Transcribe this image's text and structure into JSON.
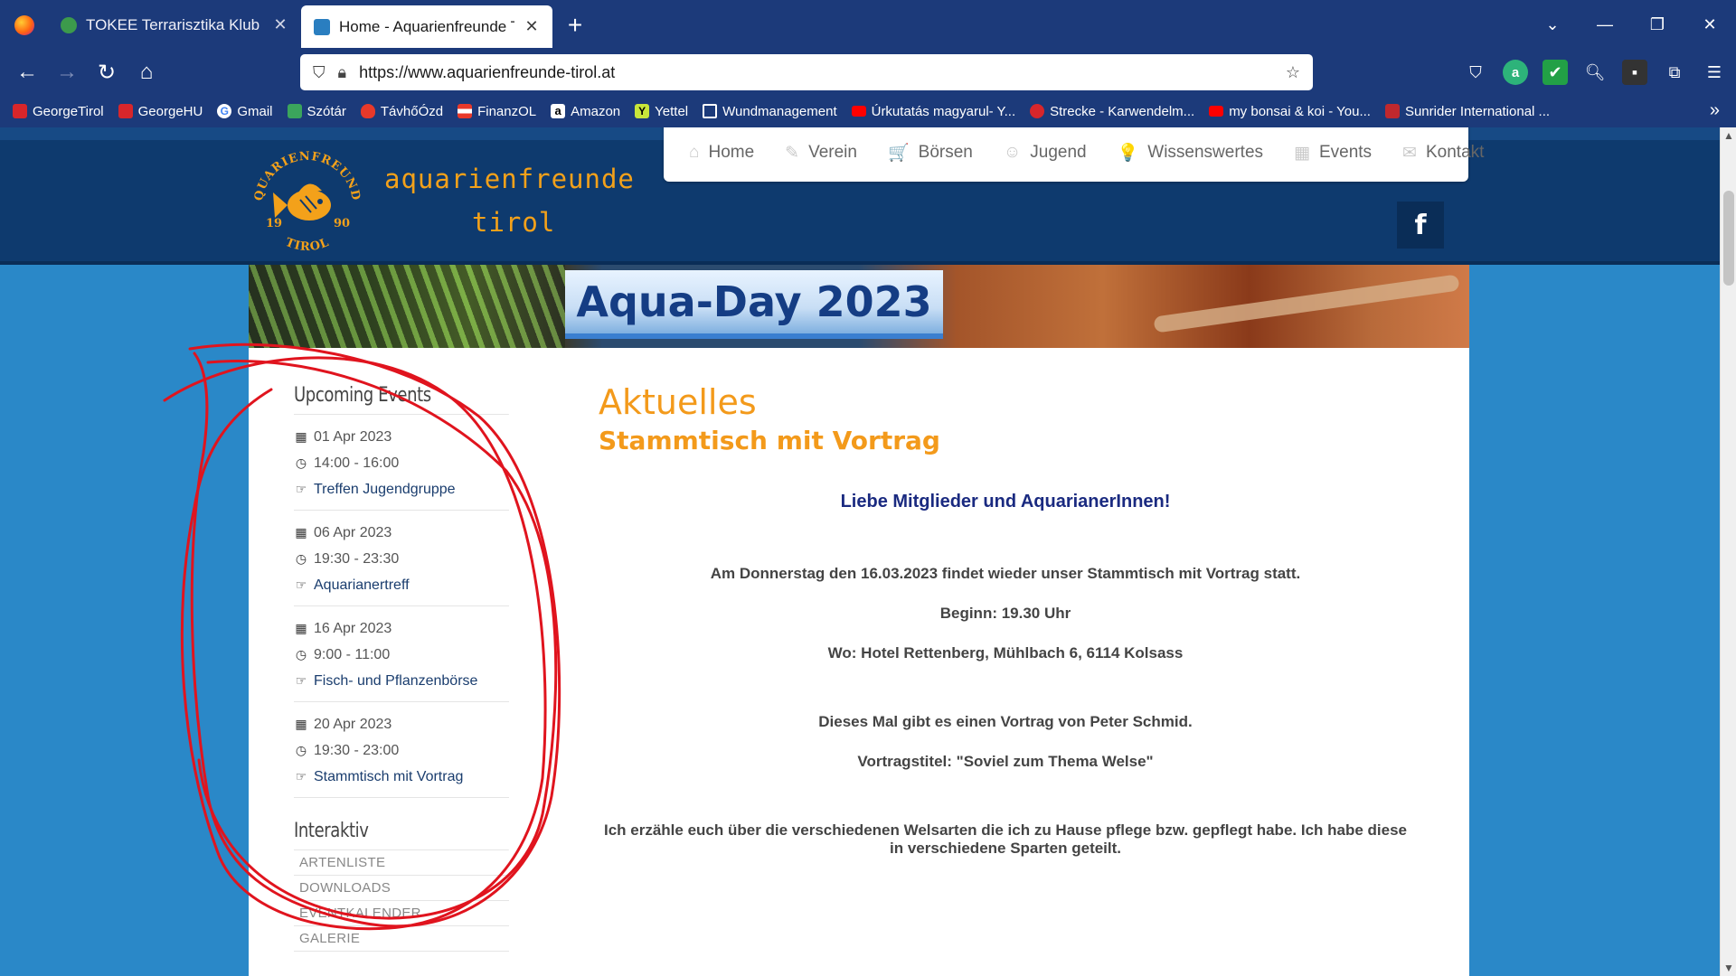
{
  "browser": {
    "tabs": [
      {
        "title": "TOKEE Terrarisztika Klub NET - (",
        "favicon_color": "#3c9a4c",
        "active": false
      },
      {
        "title": "Home - Aquarienfreunde Tirol",
        "favicon_color": "#2a7ec0",
        "active": true
      }
    ],
    "new_tab": "+",
    "url": "https://www.aquarienfreunde-tirol.at",
    "bookmarks": [
      {
        "label": "GeorgeTirol",
        "color": "#d8262b"
      },
      {
        "label": "GeorgeHU",
        "color": "#d8262b"
      },
      {
        "label": "Gmail",
        "color": "#ffffff"
      },
      {
        "label": "Szótár",
        "color": "#3ba55c"
      },
      {
        "label": "TávhőÓzd",
        "color": "#e8392a"
      },
      {
        "label": "FinanzOL",
        "color": "#e8392a"
      },
      {
        "label": "Amazon",
        "color": "#ffffff"
      },
      {
        "label": "Yettel",
        "color": "#c8e63a"
      },
      {
        "label": "Wundmanagement",
        "color": "#1c3a7a"
      },
      {
        "label": "Úrkutatás magyarul- Y...",
        "color": "#ff0000"
      },
      {
        "label": "Strecke - Karwendelm...",
        "color": "#d8262b"
      },
      {
        "label": "my bonsai & koi - You...",
        "color": "#ff0000"
      },
      {
        "label": "Sunrider International ...",
        "color": "#c0282d"
      }
    ]
  },
  "site": {
    "brand_line1": "aquarienfreunde",
    "brand_line2": "tirol",
    "logo_text_top": "AQUARIENFREUNDE",
    "logo_text_bottom": "TIROL",
    "logo_year_left": "19",
    "logo_year_right": "90",
    "menu": [
      {
        "label": "Home",
        "icon": "home-icon",
        "glyph": "⌂"
      },
      {
        "label": "Verein",
        "icon": "pin-icon",
        "glyph": "✎"
      },
      {
        "label": "Börsen",
        "icon": "cart-icon",
        "glyph": "🛒"
      },
      {
        "label": "Jugend",
        "icon": "smiley-icon",
        "glyph": "☺"
      },
      {
        "label": "Wissenswertes",
        "icon": "lightbulb-icon",
        "glyph": "💡"
      },
      {
        "label": "Events",
        "icon": "calendar-icon",
        "glyph": "▦"
      },
      {
        "label": "Kontakt",
        "icon": "envelope-icon",
        "glyph": "✉"
      }
    ],
    "facebook": "f",
    "banner_title": "Aqua-Day 2023"
  },
  "sidebar": {
    "upcoming_title": "Upcoming Events",
    "events": [
      {
        "date": "01 Apr 2023",
        "time": "14:00 - 16:00",
        "title": "Treffen Jugendgruppe"
      },
      {
        "date": "06 Apr 2023",
        "time": "19:30 - 23:30",
        "title": "Aquarianertreff"
      },
      {
        "date": "16 Apr 2023",
        "time": "9:00 - 11:00",
        "title": "Fisch- und Pflanzenbörse"
      },
      {
        "date": "20 Apr 2023",
        "time": "19:30 - 23:00",
        "title": "Stammtisch mit Vortrag"
      }
    ],
    "interaktiv_title": "Interaktiv",
    "links": [
      "ARTENLISTE",
      "DOWNLOADS",
      "EVENTKALENDER",
      "GALERIE"
    ]
  },
  "article": {
    "title": "Aktuelles",
    "subtitle": "Stammtisch mit Vortrag",
    "greeting": "Liebe Mitglieder und AquarianerInnen!",
    "p1": "Am Donnerstag den 16.03.2023 findet wieder unser Stammtisch mit Vortrag statt.",
    "p2": "Beginn: 19.30 Uhr",
    "p3": "Wo: Hotel Rettenberg, Mühlbach 6, 6114 Kolsass",
    "p4": "Dieses Mal gibt es einen Vortrag von Peter Schmid.",
    "p5": "Vortragstitel: \"Soviel zum Thema Welse\"",
    "p6": "Ich erzähle euch über die verschiedenen Welsarten die ich zu Hause pflege bzw. gepflegt habe. Ich habe diese in verschiedene Sparten geteilt."
  },
  "colors": {
    "browser_chrome": "#1c3a7a",
    "page_background": "#2a88c8",
    "header": "#0e3a6e",
    "accent_orange": "#f39a1b",
    "annotation_red": "#e0141e"
  }
}
